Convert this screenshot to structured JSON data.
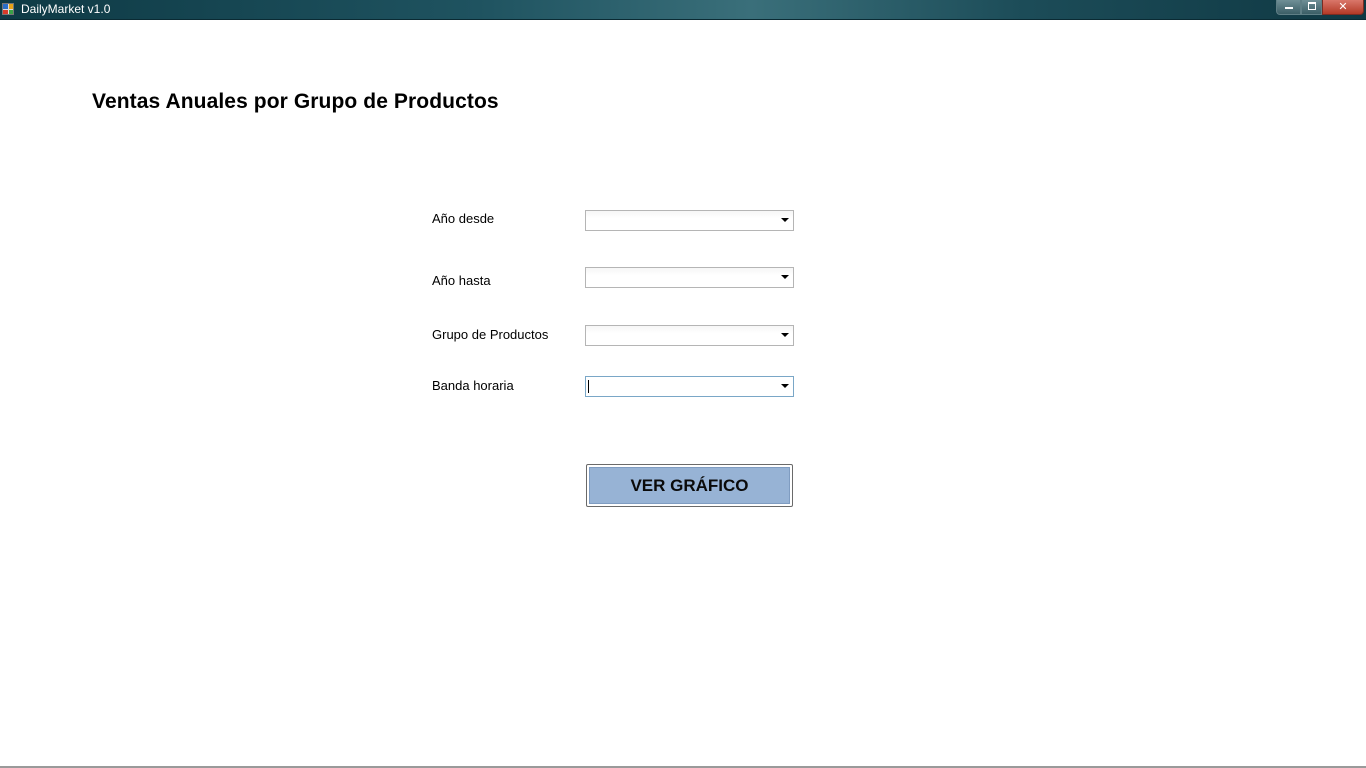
{
  "window": {
    "title": "DailyMarket v1.0",
    "icon": "app-icon",
    "controls": {
      "minimize_icon": "minimize-icon",
      "maximize_icon": "restore-icon",
      "close_label": "✕"
    }
  },
  "page": {
    "title": "Ventas Anuales por Grupo de Productos"
  },
  "form": {
    "year_from": {
      "label": "Año desde",
      "value": ""
    },
    "year_to": {
      "label": "Año hasta",
      "value": ""
    },
    "product_group": {
      "label": "Grupo de Productos",
      "value": ""
    },
    "time_band": {
      "label": "Banda horaria",
      "value": ""
    },
    "submit_label": "VER GRÁFICO"
  },
  "colors": {
    "button_fill": "#97b3d5",
    "titlebar": "#1f5360",
    "close_button": "#c9503d"
  }
}
